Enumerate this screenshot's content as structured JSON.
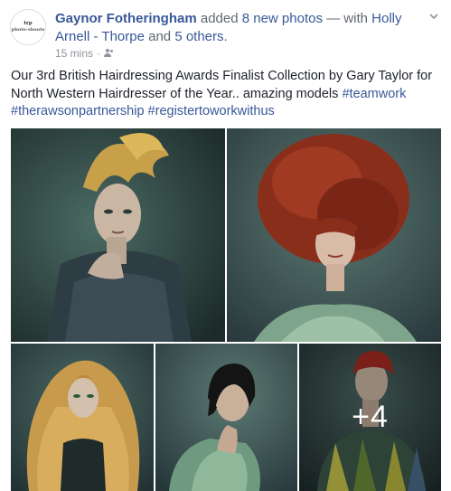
{
  "post": {
    "avatar_text_1": "trp",
    "avatar_text_2": "photo-shoots",
    "author": "Gaynor Fotheringham",
    "action": " added ",
    "photo_count_link": "8 new photos",
    "with_text": " — with ",
    "tagged_person": "Holly Arnell - Thorpe",
    "and_text": " and ",
    "others_link": "5 others",
    "period": ".",
    "timestamp": "15 mins",
    "separator": " · ",
    "audience_icon": "friends-icon",
    "body_text": "Our 3rd British Hairdressing Awards Finalist Collection by Gary Taylor for North Western Hairdresser of the Year.. amazing models ",
    "hashtags": [
      "#teamwork",
      "#therawsonpartnership",
      "#registertoworkwithus"
    ],
    "more_photos_label": "+4"
  },
  "photos": [
    {
      "name": "photo-blonde-quiff-model",
      "desc": ""
    },
    {
      "name": "photo-red-afro-model",
      "desc": ""
    },
    {
      "name": "photo-long-curly-blonde-model",
      "desc": ""
    },
    {
      "name": "photo-black-bob-model",
      "desc": ""
    },
    {
      "name": "photo-red-fringe-model",
      "desc": ""
    }
  ],
  "colors": {
    "link": "#385898",
    "meta": "#90949c",
    "text": "#1d2129"
  }
}
